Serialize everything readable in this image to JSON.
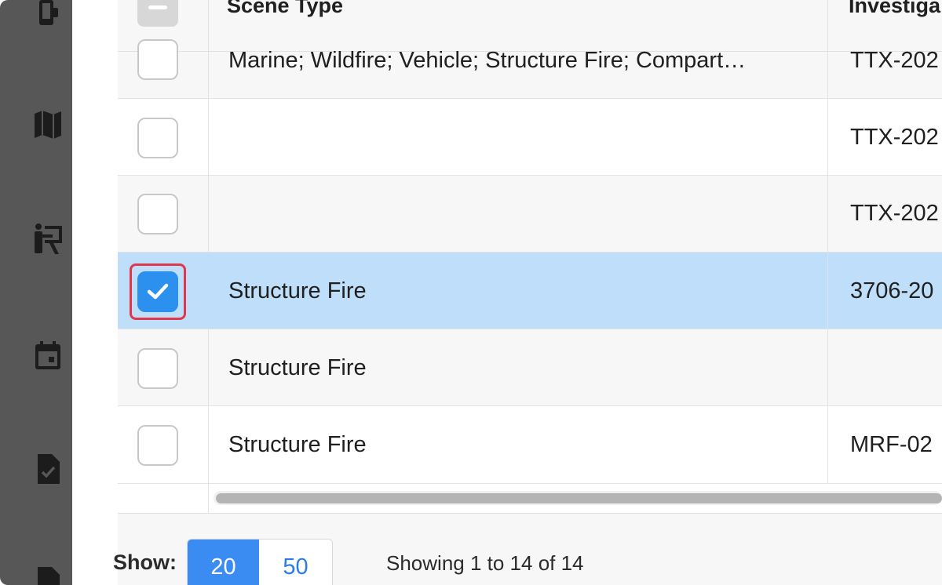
{
  "table": {
    "columns": [
      "Scene Type",
      "Investiga"
    ],
    "rows": [
      {
        "scene_type": "Marine; Wildfire; Vehicle; Structure Fire; Compart…",
        "investigation": "TTX-202",
        "checked": false
      },
      {
        "scene_type": "",
        "investigation": "TTX-202",
        "checked": false
      },
      {
        "scene_type": "",
        "investigation": "TTX-202",
        "checked": false
      },
      {
        "scene_type": "Structure Fire",
        "investigation": "3706-20",
        "checked": true
      },
      {
        "scene_type": "Structure Fire",
        "investigation": "",
        "checked": false
      },
      {
        "scene_type": "Structure Fire",
        "investigation": "MRF-02",
        "checked": false
      }
    ]
  },
  "footer": {
    "show_label": "Show:",
    "page_sizes": [
      "20",
      "50"
    ],
    "active_page_size": "20",
    "showing_text": "Showing 1 to 14 of 14"
  },
  "sidebar": {
    "icons": [
      "phone-icon",
      "map-icon",
      "presenter-icon",
      "calendar-icon",
      "document-check-icon",
      "document-icon"
    ]
  },
  "colors": {
    "sidebar": "#575757",
    "selected_row": "#bfdef9",
    "checkbox_checked": "#2b90ee",
    "highlight": "#e0384b",
    "accent": "#3b8cf2"
  }
}
